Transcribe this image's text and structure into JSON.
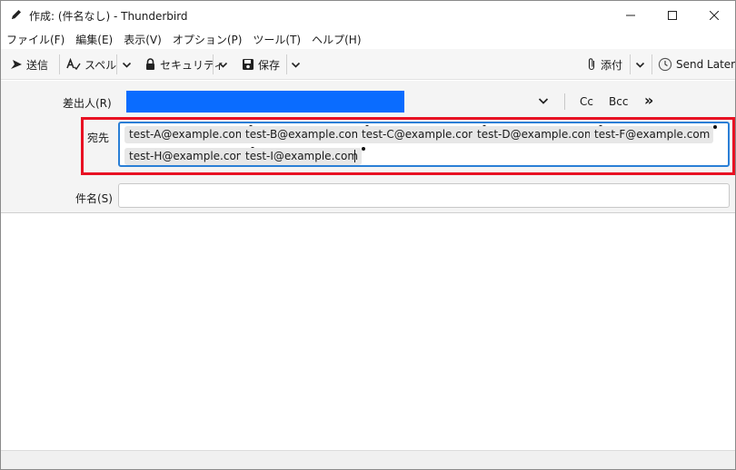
{
  "window": {
    "title": "作成: (件名なし) - Thunderbird"
  },
  "menu": {
    "items": [
      "ファイル(F)",
      "編集(E)",
      "表示(V)",
      "オプション(P)",
      "ツール(T)",
      "ヘルプ(H)"
    ]
  },
  "toolbar": {
    "send_label": "送信",
    "spell_label": "スペル",
    "security_label": "セキュリティ",
    "save_label": "保存",
    "attach_label": "添付",
    "send_later_label": "Send Later"
  },
  "headers": {
    "from_label": "差出人(R)",
    "cc_label": "Cc",
    "bcc_label": "Bcc",
    "more_label": "»",
    "to_label": "宛先",
    "subject_label": "件名(S)",
    "subject_value": ""
  },
  "recipients": [
    "test-A@example.com",
    "test-B@example.com",
    "test-C@example.com",
    "test-D@example.com",
    "test-F@example.com",
    "test-H@example.com",
    "test-I@example.com"
  ],
  "colors": {
    "from_selected": "#0a6cff",
    "to_focus_border": "#2a7fd6",
    "highlight_box": "#e81123"
  },
  "icons": {
    "title": "pencil-icon",
    "send": "send-icon",
    "spell": "spellcheck-icon",
    "security": "lock-icon",
    "save": "save-icon",
    "attach": "paperclip-icon",
    "send_later": "clock-icon"
  }
}
